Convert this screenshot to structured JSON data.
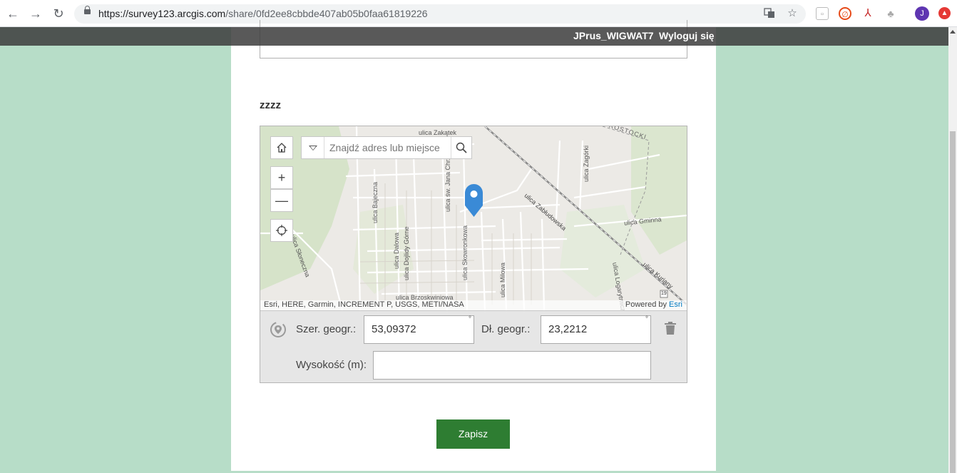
{
  "browser": {
    "url_host": "https://survey123.arcgis.com",
    "url_path": "/share/0fd2ee8cbbde407ab05b0faa61819226",
    "profile_initial": "J"
  },
  "header": {
    "username": "JPrus_WIGWAT7",
    "logout_label": "Wyloguj się"
  },
  "question": {
    "label": "zzzz"
  },
  "map": {
    "search_placeholder": "Znajdź adres lub miejsce",
    "attribution": "Esri, HERE, Garmin, INCREMENT P, USGS, METI/NASA",
    "powered_by": "Powered by",
    "powered_by_brand": "Esri",
    "street_labels": [
      "ulica Zabłudowska",
      "ulica Gminna",
      "ulica Kuriany",
      "ulica Brzoskwiniowa",
      "ulica Milowa",
      "ulica Skowronkowa",
      "ulica Dalowa",
      "ulica Dojlidy Górne",
      "ulica Bajeczna",
      "ulica św. Jana Chrzciciela",
      "ulica Zagórki",
      "ulica Logarytmiczna",
      "ulica Zakątek",
      "ulica Słoneczna",
      "ROSTOCKI",
      "19"
    ]
  },
  "coordinates": {
    "lat_label": "Szer. geogr.:",
    "lat_value": "53,09372",
    "lon_label": "Dł. geogr.:",
    "lon_value": "23,2212",
    "alt_label": "Wysokość (m):",
    "alt_value": "",
    "degree_symbol": "°"
  },
  "form": {
    "save_label": "Zapisz"
  },
  "colors": {
    "page_background": "#b7ddc8",
    "save_button": "#2e7d32",
    "pin": "#3a8ad6"
  }
}
